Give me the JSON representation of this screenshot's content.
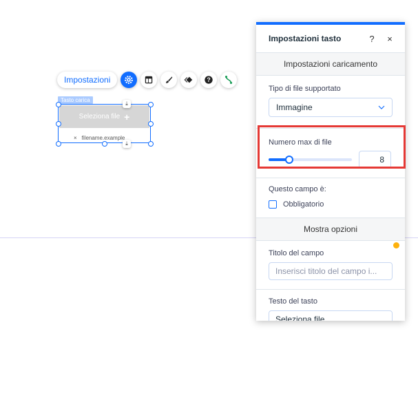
{
  "toolbar": {
    "settings_label": "Impostazioni",
    "icons": [
      "gear-icon",
      "layout-icon",
      "brush-icon",
      "animation-icon",
      "help-icon",
      "connect-icon"
    ],
    "active_color": "#116dff"
  },
  "element": {
    "tag_label": "Tasto carica",
    "button_text": "Seleziona file",
    "plus": "+",
    "file_remove": "×",
    "filename": "filename.example"
  },
  "panel": {
    "title": "Impostazioni tasto",
    "help": "?",
    "close": "×",
    "section_upload": "Impostazioni caricamento",
    "file_type_label": "Tipo di file supportato",
    "file_type_value": "Immagine",
    "max_files_label": "Numero max di file",
    "max_files_value": "8",
    "max_files_slider_fraction": 0.25,
    "field_is_label": "Questo campo è:",
    "required_label": "Obbligatorio",
    "required_checked": false,
    "section_options": "Mostra opzioni",
    "field_title_label": "Titolo del campo",
    "field_title_placeholder": "Inserisci titolo del campo i...",
    "button_text_label": "Testo del tasto",
    "button_text_value": "Seleziona file"
  },
  "colors": {
    "accent": "#116dff",
    "highlight": "#e53935",
    "warning": "#fdb10c"
  }
}
